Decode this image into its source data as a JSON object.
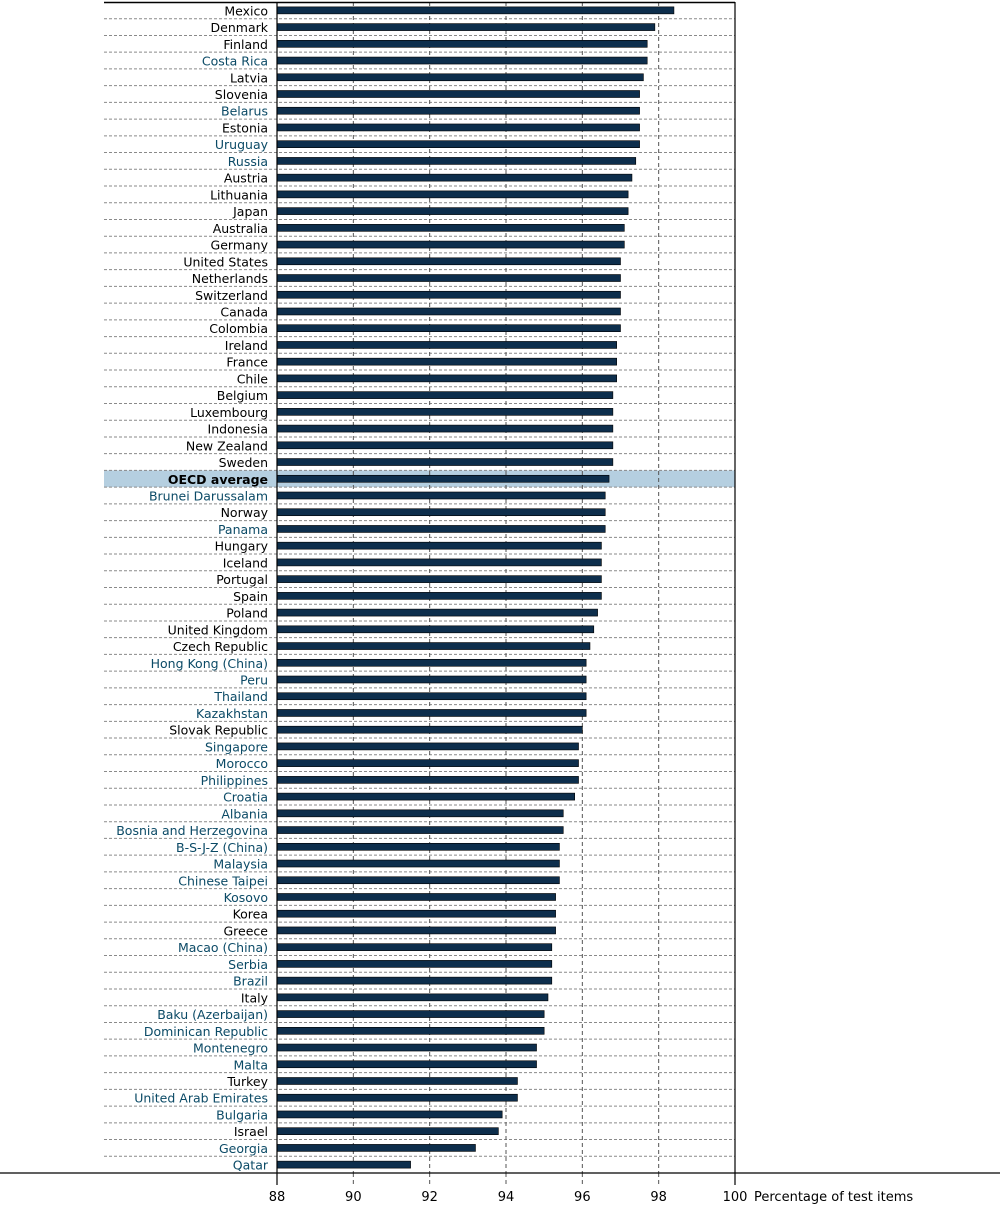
{
  "chart_data": {
    "type": "bar",
    "orientation": "horizontal",
    "title": "",
    "xlabel": "Percentage of test items",
    "ylabel": "",
    "xlim": [
      88,
      100
    ],
    "xticks": [
      "88",
      "90",
      "92",
      "94",
      "96",
      "98",
      "100"
    ],
    "grid": true,
    "legend": "none",
    "colors": {
      "bar": "#0d2e4c",
      "oecd_label": "#000000",
      "partner_label": "#0b4a66",
      "highlight_band": "#b5cfe0"
    },
    "highlighted_category": "OECD average",
    "categories": [
      "Mexico",
      "Denmark",
      "Finland",
      "Costa Rica",
      "Latvia",
      "Slovenia",
      "Belarus",
      "Estonia",
      "Uruguay",
      "Russia",
      "Austria",
      "Lithuania",
      "Japan",
      "Australia",
      "Germany",
      "United States",
      "Netherlands",
      "Switzerland",
      "Canada",
      "Colombia",
      "Ireland",
      "France",
      "Chile",
      "Belgium",
      "Luxembourg",
      "Indonesia",
      "New Zealand",
      "Sweden",
      "OECD average",
      "Brunei Darussalam",
      "Norway",
      "Panama",
      "Hungary",
      "Iceland",
      "Portugal",
      "Spain",
      "Poland",
      "United Kingdom",
      "Czech Republic",
      "Hong Kong (China)",
      "Peru",
      "Thailand",
      "Kazakhstan",
      "Slovak Republic",
      "Singapore",
      "Morocco",
      "Philippines",
      "Croatia",
      "Albania",
      "Bosnia and Herzegovina",
      "B-S-J-Z (China)",
      "Malaysia",
      "Chinese Taipei",
      "Kosovo",
      "Korea",
      "Greece",
      "Macao (China)",
      "Serbia",
      "Brazil",
      "Italy",
      "Baku (Azerbaijan)",
      "Dominican Republic",
      "Montenegro",
      "Malta",
      "Turkey",
      "United Arab Emirates",
      "Bulgaria",
      "Israel",
      "Georgia",
      "Qatar"
    ],
    "label_group": [
      "oecd",
      "oecd",
      "oecd",
      "partner",
      "oecd",
      "oecd",
      "partner",
      "oecd",
      "partner",
      "partner",
      "oecd",
      "oecd",
      "oecd",
      "oecd",
      "oecd",
      "oecd",
      "oecd",
      "oecd",
      "oecd",
      "oecd",
      "oecd",
      "oecd",
      "oecd",
      "oecd",
      "oecd",
      "oecd",
      "oecd",
      "oecd",
      "average",
      "partner",
      "oecd",
      "partner",
      "oecd",
      "oecd",
      "oecd",
      "oecd",
      "oecd",
      "oecd",
      "oecd",
      "partner",
      "partner",
      "partner",
      "partner",
      "oecd",
      "partner",
      "partner",
      "partner",
      "partner",
      "partner",
      "partner",
      "partner",
      "partner",
      "partner",
      "partner",
      "oecd",
      "oecd",
      "partner",
      "partner",
      "partner",
      "oecd",
      "partner",
      "partner",
      "partner",
      "partner",
      "oecd",
      "partner",
      "partner",
      "oecd",
      "partner",
      "partner"
    ],
    "values": [
      98.4,
      97.9,
      97.7,
      97.7,
      97.6,
      97.5,
      97.5,
      97.5,
      97.5,
      97.4,
      97.3,
      97.2,
      97.2,
      97.1,
      97.1,
      97.0,
      97.0,
      97.0,
      97.0,
      97.0,
      96.9,
      96.9,
      96.9,
      96.8,
      96.8,
      96.8,
      96.8,
      96.8,
      96.7,
      96.6,
      96.6,
      96.6,
      96.5,
      96.5,
      96.5,
      96.5,
      96.4,
      96.3,
      96.2,
      96.1,
      96.1,
      96.1,
      96.1,
      96.0,
      95.9,
      95.9,
      95.9,
      95.8,
      95.5,
      95.5,
      95.4,
      95.4,
      95.4,
      95.3,
      95.3,
      95.3,
      95.2,
      95.2,
      95.2,
      95.1,
      95.0,
      95.0,
      94.8,
      94.8,
      94.3,
      94.3,
      93.9,
      93.8,
      93.2,
      91.5
    ]
  }
}
